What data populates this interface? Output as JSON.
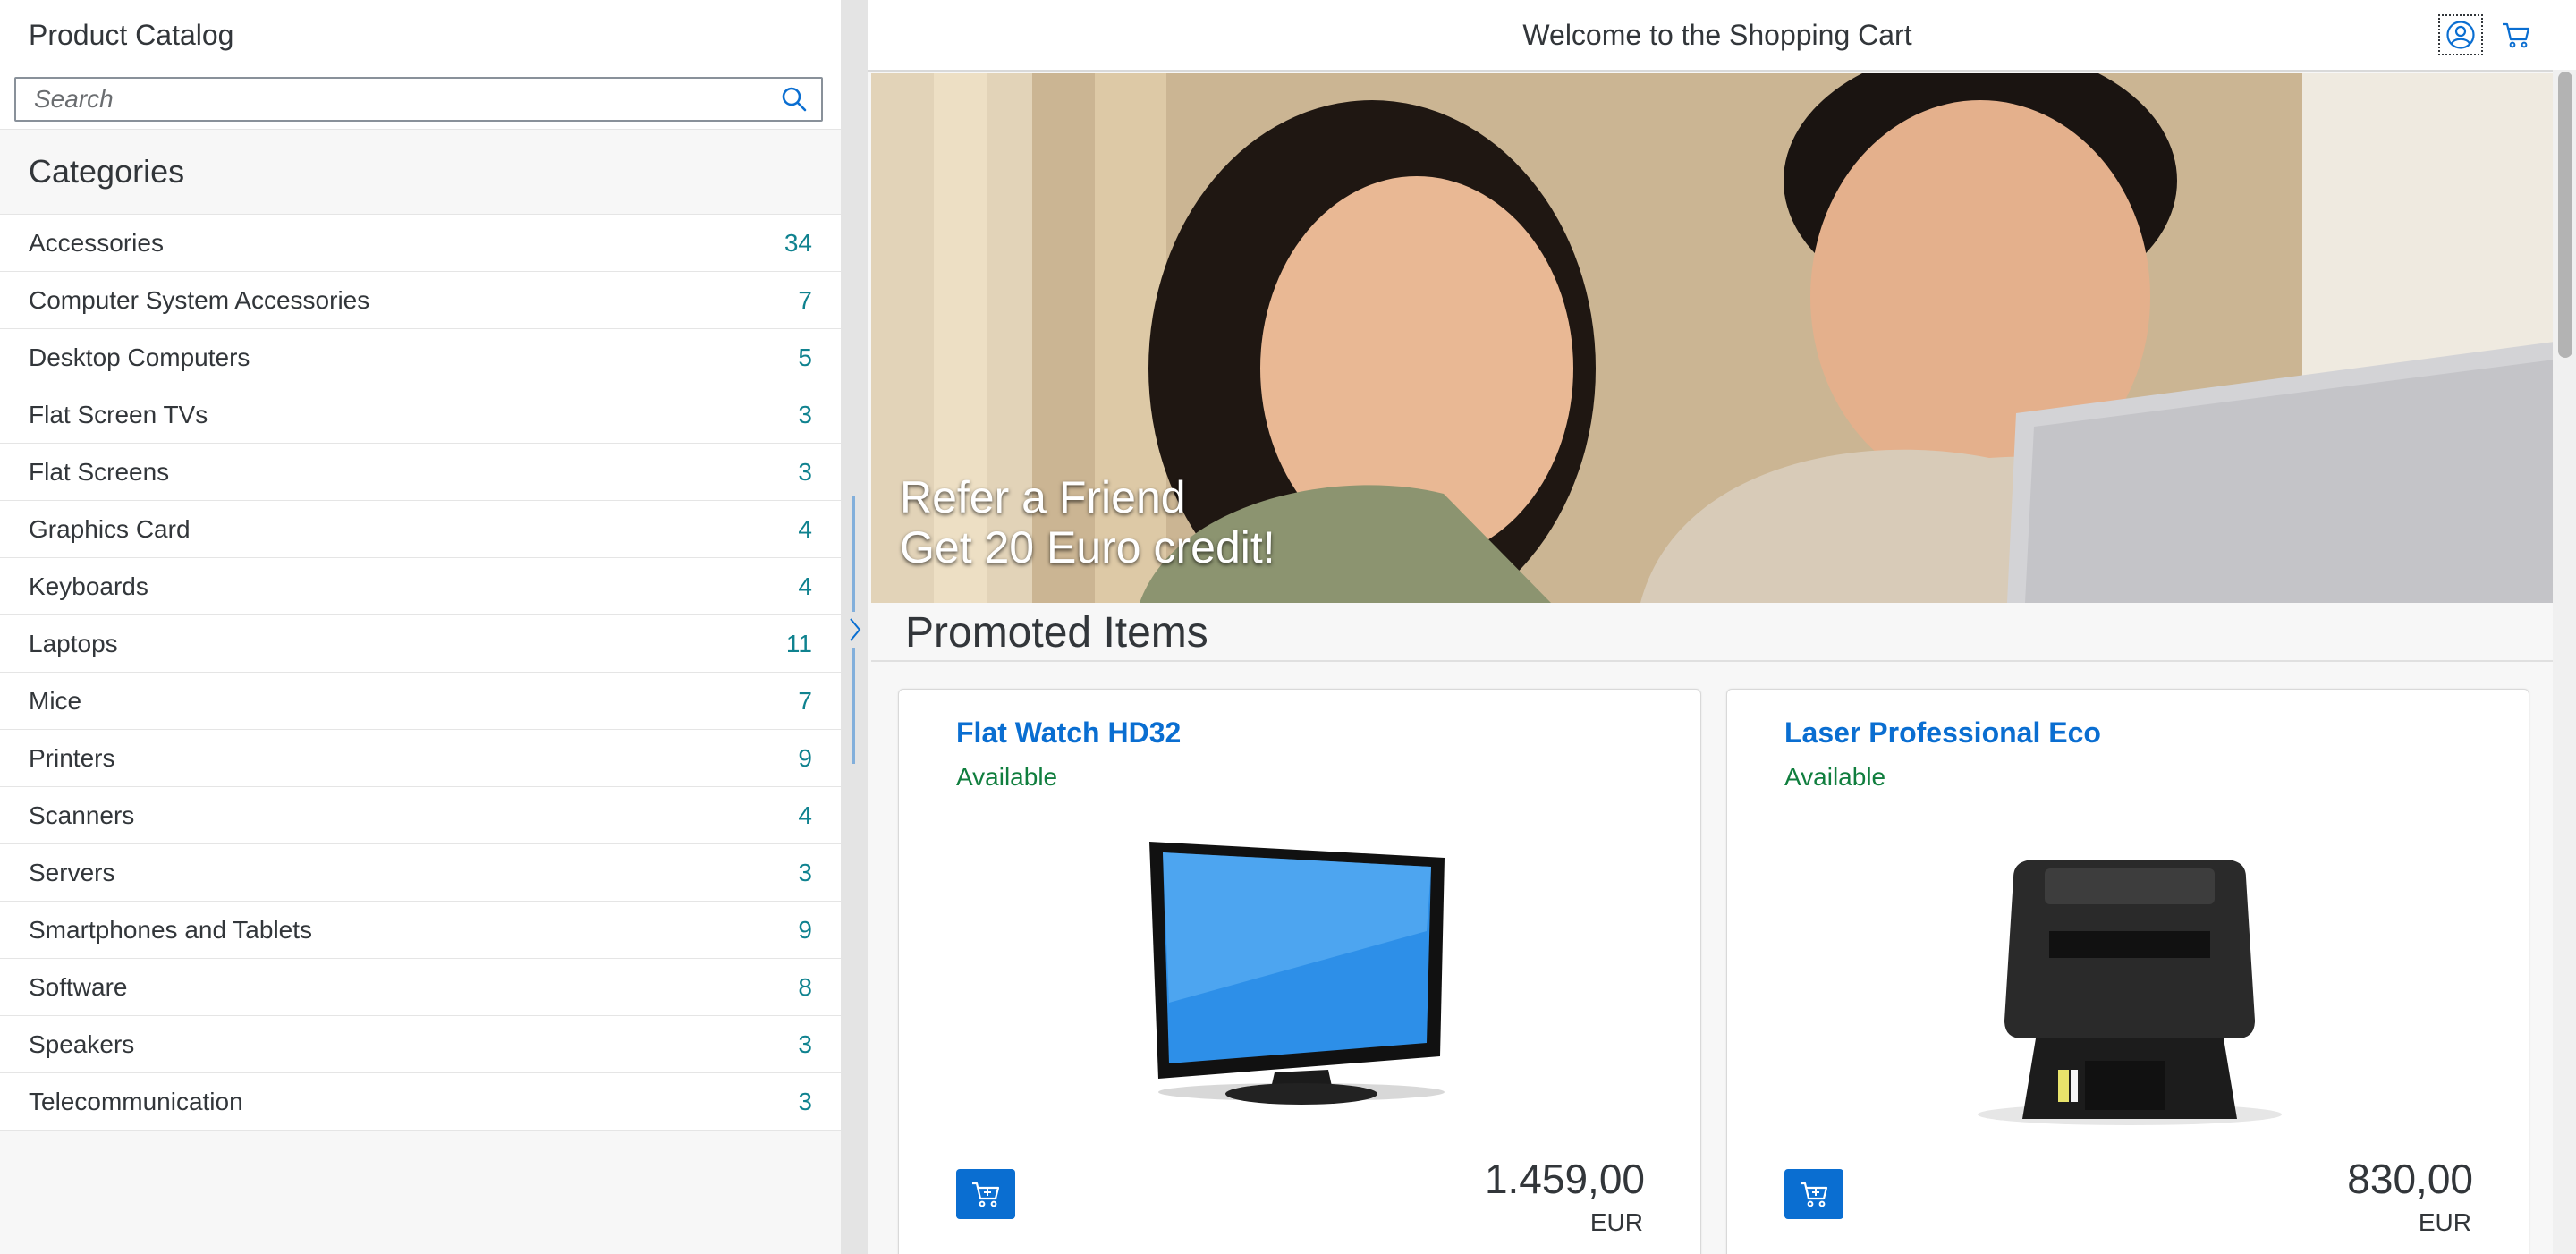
{
  "master": {
    "title": "Product Catalog",
    "search_placeholder": "Search",
    "list_header": "Categories",
    "categories": [
      {
        "label": "Accessories",
        "count": "34"
      },
      {
        "label": "Computer System Accessories",
        "count": "7"
      },
      {
        "label": "Desktop Computers",
        "count": "5"
      },
      {
        "label": "Flat Screen TVs",
        "count": "3"
      },
      {
        "label": "Flat Screens",
        "count": "3"
      },
      {
        "label": "Graphics Card",
        "count": "4"
      },
      {
        "label": "Keyboards",
        "count": "4"
      },
      {
        "label": "Laptops",
        "count": "11"
      },
      {
        "label": "Mice",
        "count": "7"
      },
      {
        "label": "Printers",
        "count": "9"
      },
      {
        "label": "Scanners",
        "count": "4"
      },
      {
        "label": "Servers",
        "count": "3"
      },
      {
        "label": "Smartphones and Tablets",
        "count": "9"
      },
      {
        "label": "Software",
        "count": "8"
      },
      {
        "label": "Speakers",
        "count": "3"
      },
      {
        "label": "Telecommunication",
        "count": "3"
      }
    ]
  },
  "detail": {
    "title": "Welcome to the Shopping Cart",
    "icons": {
      "avatar": "user-avatar-icon",
      "cart": "shopping-cart-icon",
      "search": "search-icon"
    },
    "banner": {
      "line1": "Refer a Friend",
      "line2": "Get 20 Euro credit!"
    },
    "promoted_title": "Promoted Items",
    "products": [
      {
        "name": "Flat Watch HD32",
        "status": "Available",
        "price": "1.459,00",
        "currency": "EUR"
      },
      {
        "name": "Laser Professional Eco",
        "status": "Available",
        "price": "830,00",
        "currency": "EUR"
      }
    ]
  },
  "colors": {
    "accent": "#0a6ed1",
    "count": "#0f828f",
    "available": "#107e3e",
    "text": "#32363a"
  }
}
